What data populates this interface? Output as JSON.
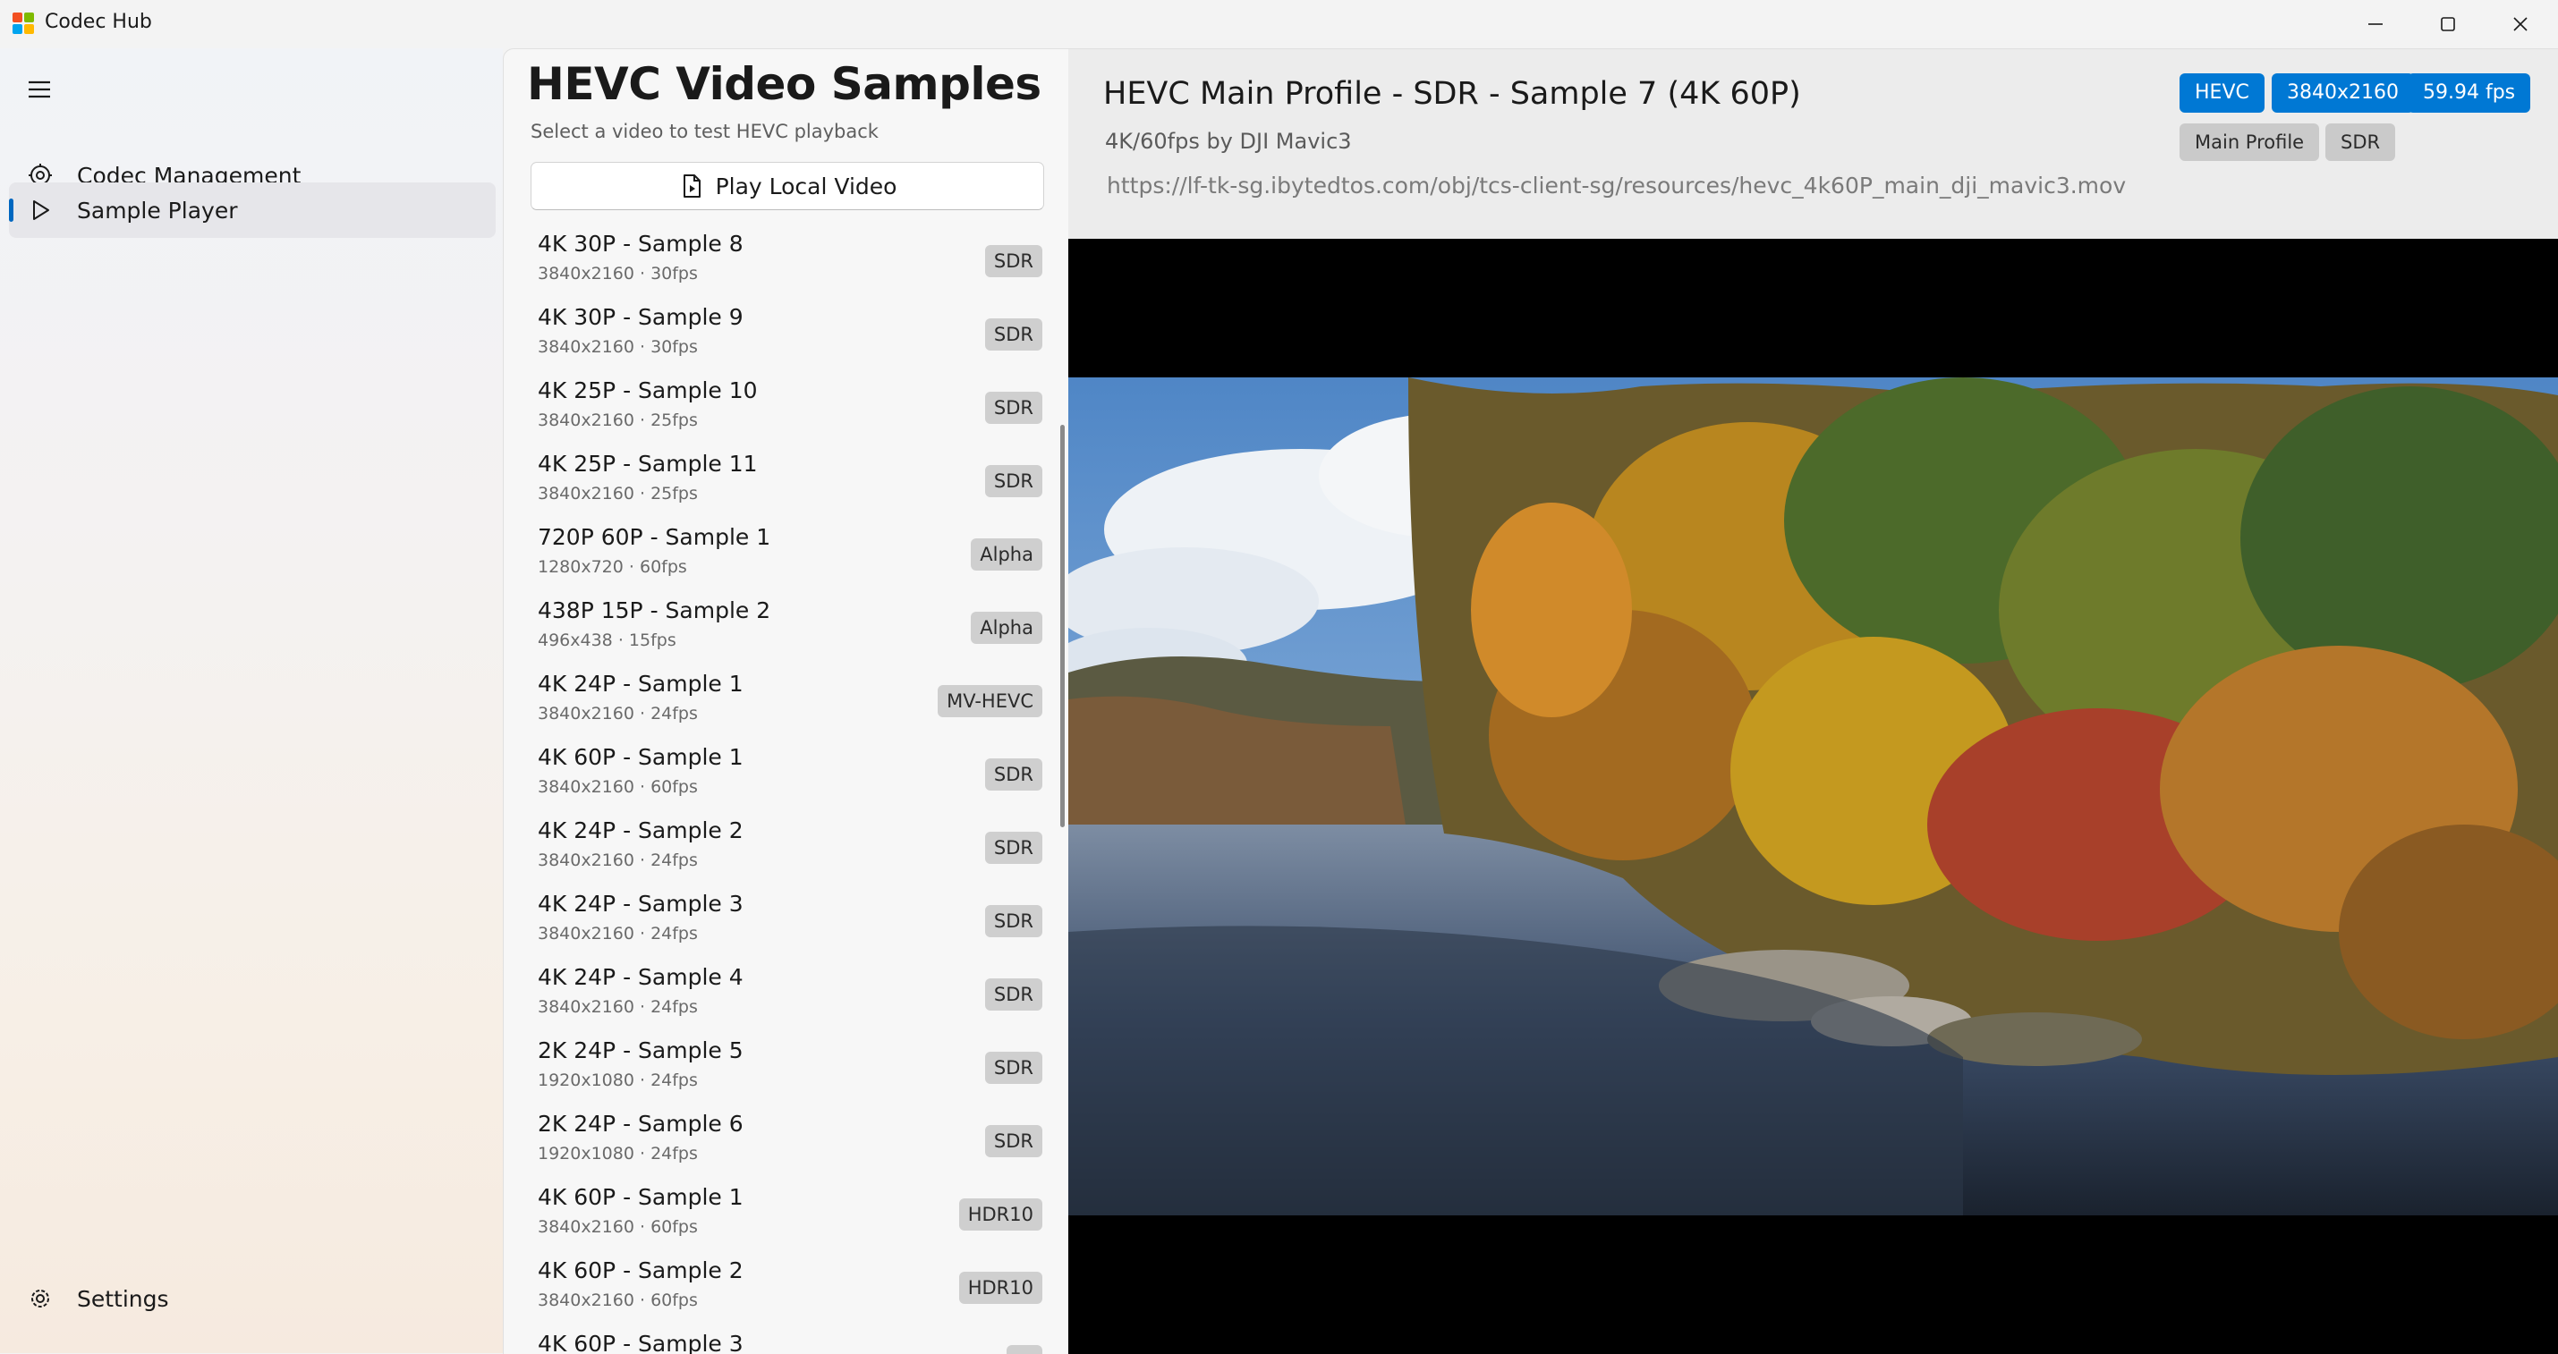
{
  "window": {
    "title": "Codec Hub",
    "controls": [
      "minimize-icon",
      "maximize-icon",
      "close-icon"
    ]
  },
  "nav": {
    "items": [
      {
        "label": "Codec Management",
        "icon": "codec-gear-icon",
        "selected": false
      },
      {
        "label": "Sample Player",
        "icon": "play-icon",
        "selected": true
      }
    ],
    "footer": {
      "label": "Settings",
      "icon": "gear-icon"
    }
  },
  "list": {
    "title": "HEVC Video Samples",
    "subtitle": "Select a video to test HEVC playback",
    "play_local_label": "Play Local Video",
    "items": [
      {
        "title": "4K 30P - Sample 8",
        "meta": "3840x2160 · 30fps",
        "badge": "SDR"
      },
      {
        "title": "4K 30P - Sample 9",
        "meta": "3840x2160 · 30fps",
        "badge": "SDR"
      },
      {
        "title": "4K 25P - Sample 10",
        "meta": "3840x2160 · 25fps",
        "badge": "SDR"
      },
      {
        "title": "4K 25P - Sample 11",
        "meta": "3840x2160 · 25fps",
        "badge": "SDR"
      },
      {
        "title": "720P 60P - Sample 1",
        "meta": "1280x720 · 60fps",
        "badge": "Alpha"
      },
      {
        "title": "438P 15P - Sample 2",
        "meta": "496x438 · 15fps",
        "badge": "Alpha"
      },
      {
        "title": "4K 24P - Sample 1",
        "meta": "3840x2160 · 24fps",
        "badge": "MV-HEVC"
      },
      {
        "title": "4K 60P - Sample 1",
        "meta": "3840x2160 · 60fps",
        "badge": "SDR"
      },
      {
        "title": "4K 24P - Sample 2",
        "meta": "3840x2160 · 24fps",
        "badge": "SDR"
      },
      {
        "title": "4K 24P - Sample 3",
        "meta": "3840x2160 · 24fps",
        "badge": "SDR"
      },
      {
        "title": "4K 24P - Sample 4",
        "meta": "3840x2160 · 24fps",
        "badge": "SDR"
      },
      {
        "title": "2K 24P - Sample 5",
        "meta": "1920x1080 · 24fps",
        "badge": "SDR"
      },
      {
        "title": "2K 24P - Sample 6",
        "meta": "1920x1080 · 24fps",
        "badge": "SDR"
      },
      {
        "title": "4K 60P - Sample 1",
        "meta": "3840x2160 · 60fps",
        "badge": "HDR10"
      },
      {
        "title": "4K 60P - Sample 2",
        "meta": "3840x2160 · 60fps",
        "badge": "HDR10"
      },
      {
        "title": "4K 60P - Sample 3",
        "meta": "",
        "badge": ""
      }
    ]
  },
  "detail": {
    "title": "HEVC Main Profile - SDR - Sample 7 (4K 60P)",
    "subtitle": "4K/60fps by DJI Mavic3",
    "url": "https://lf-tk-sg.ibytedtos.com/obj/tcs-client-sg/resources/hevc_4k60P_main_dji_mavic3.mov",
    "tags_primary": [
      "HEVC",
      "3840x2160",
      "59.94 fps"
    ],
    "tags_secondary": [
      "Main Profile",
      "SDR"
    ]
  },
  "colors": {
    "accent": "#0078d4",
    "badge_grey": "#cfcfcf",
    "nav_selected": "#e6e6ea",
    "video_bg": "#000000"
  }
}
